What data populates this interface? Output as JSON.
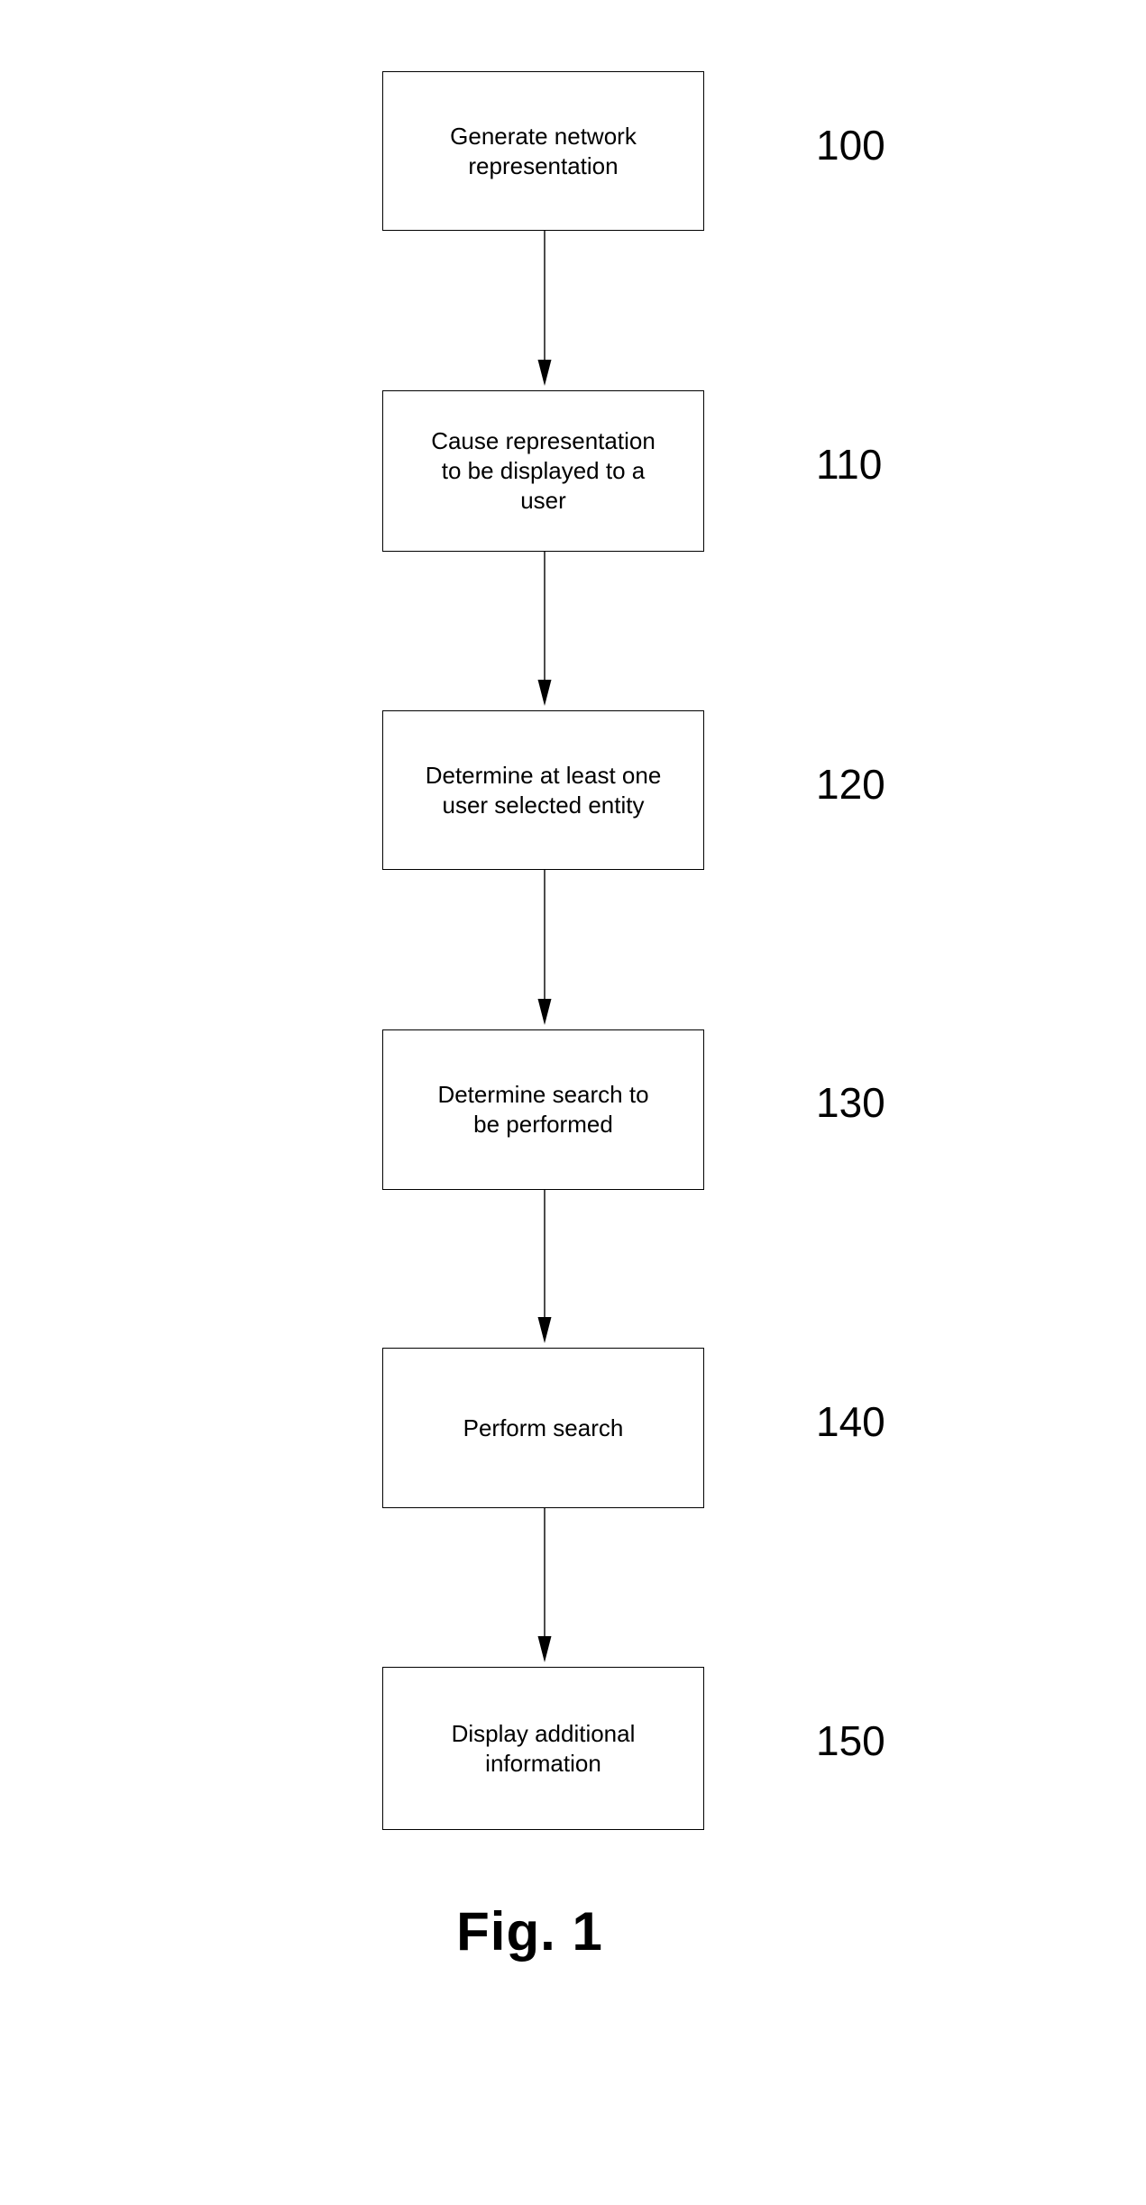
{
  "figure": {
    "caption": "Fig. 1",
    "type": "flowchart",
    "steps": [
      {
        "ref": "100",
        "label": "Generate network\nrepresentation"
      },
      {
        "ref": "110",
        "label": "Cause representation\nto be displayed to a\nuser"
      },
      {
        "ref": "120",
        "label": "Determine at least one\nuser selected entity"
      },
      {
        "ref": "130",
        "label": "Determine search to\nbe performed"
      },
      {
        "ref": "140",
        "label": "Perform search"
      },
      {
        "ref": "150",
        "label": "Display additional\ninformation"
      }
    ],
    "connectors": [
      {
        "from": "100",
        "to": "110",
        "style": "arrow-down"
      },
      {
        "from": "110",
        "to": "120",
        "style": "arrow-down"
      },
      {
        "from": "120",
        "to": "130",
        "style": "arrow-down"
      },
      {
        "from": "130",
        "to": "140",
        "style": "arrow-down"
      },
      {
        "from": "140",
        "to": "150",
        "style": "arrow-down"
      }
    ],
    "colors": {
      "stroke": "#000000",
      "fill": "#ffffff",
      "text": "#000000"
    }
  }
}
